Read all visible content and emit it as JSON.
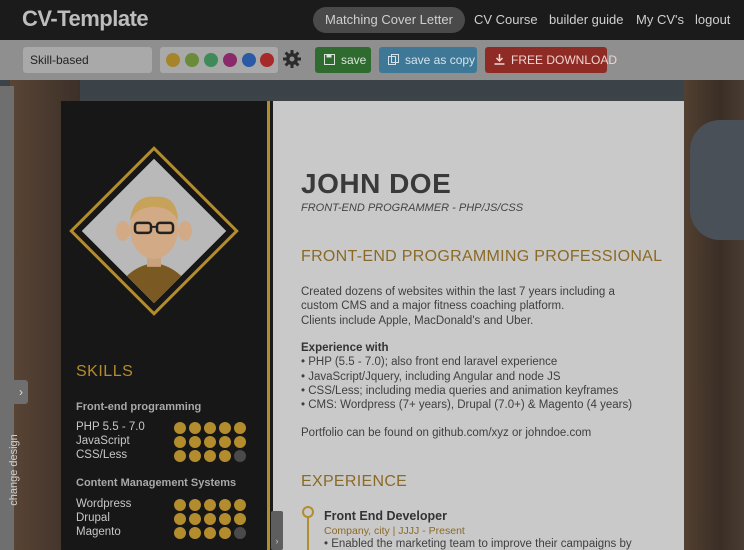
{
  "app": {
    "logo": "CV-Template"
  },
  "nav": {
    "cover_letter": "Matching Cover Letter",
    "cv_course": "CV Course",
    "builder_guide": "builder guide",
    "my_cvs": "My CV's",
    "logout": "logout"
  },
  "toolbar": {
    "template_value": "Skill-based",
    "swatches": [
      "#a6842a",
      "#6b8a3a",
      "#3f8a5a",
      "#8a2a6a",
      "#2a5aa6",
      "#a62a2a"
    ],
    "save_label": "save",
    "save_copy_label": "save as copy",
    "download_label": "FREE DOWNLOAD",
    "save_color": "#2f6a2f",
    "save_copy_color": "#3f7896",
    "download_color": "#8f2b25"
  },
  "side": {
    "change_design": "change design"
  },
  "resume": {
    "name": "JOHN DOE",
    "role": "FRONT-END PROGRAMMER - PHP/JS/CSS",
    "accent": "#b38c2e",
    "skills_title": "SKILLS",
    "skill_groups": [
      {
        "title": "Front-end programming",
        "items": [
          {
            "name": "PHP 5.5 - 7.0",
            "level": 5
          },
          {
            "name": "JavaScript",
            "level": 5
          },
          {
            "name": "CSS/Less",
            "level": 4
          }
        ]
      },
      {
        "title": "Content Management Systems",
        "items": [
          {
            "name": "Wordpress",
            "level": 5
          },
          {
            "name": "Drupal",
            "level": 5
          },
          {
            "name": "Magento",
            "level": 4
          }
        ]
      }
    ],
    "headline": "FRONT-END PROGRAMMING PROFESSIONAL",
    "summary": [
      "Created dozens of websites within the last 7 years including a",
      "custom CMS and a major fitness coaching platform.",
      "Clients include Apple, MacDonald's and Uber."
    ],
    "experience_with_title": "Experience with",
    "experience_with": [
      "• PHP (5.5 - 7.0); also front end laravel experience",
      "• JavaScript/Jquery, including Angular and node JS",
      "• CSS/Less; including media queries and animation keyframes",
      "• CMS: Wordpress (7+ years), Drupal (7.0+) & Magento (4 years)"
    ],
    "portfolio": "Portfolio can be found on github.com/xyz or johndoe.com",
    "experience_title": "EXPERIENCE",
    "job": {
      "title": "Front End Developer",
      "meta": "Company, city | JJJJ - Present",
      "bullet": "• Enabled the marketing team to improve their campaigns by"
    }
  }
}
